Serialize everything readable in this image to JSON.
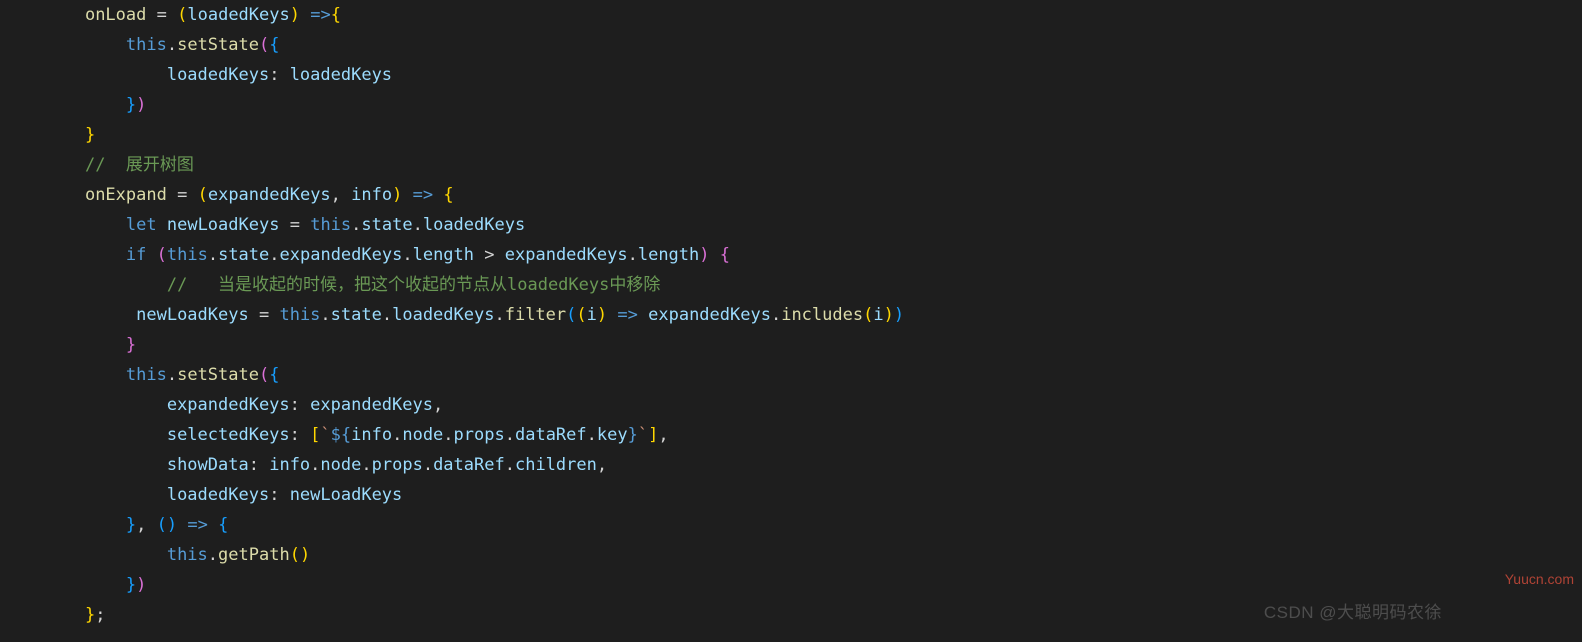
{
  "lines": [
    {
      "indent": "    ",
      "tokens": [
        {
          "t": "onLoad",
          "c": "tk-fn"
        },
        {
          "t": " "
        },
        {
          "t": "=",
          "c": "tk-op"
        },
        {
          "t": " "
        },
        {
          "t": "(",
          "c": "tk-brace-y"
        },
        {
          "t": "loadedKeys",
          "c": "tk-var"
        },
        {
          "t": ")",
          "c": "tk-brace-y"
        },
        {
          "t": " "
        },
        {
          "t": "=>",
          "c": "tk-kw"
        },
        {
          "t": "{",
          "c": "tk-brace-y"
        }
      ]
    },
    {
      "indent": "        ",
      "tokens": [
        {
          "t": "this",
          "c": "tk-this"
        },
        {
          "t": ".",
          "c": "tk-punc"
        },
        {
          "t": "setState",
          "c": "tk-fn"
        },
        {
          "t": "(",
          "c": "tk-brace-p"
        },
        {
          "t": "{",
          "c": "tk-brace-b"
        }
      ]
    },
    {
      "indent": "            ",
      "tokens": [
        {
          "t": "loadedKeys",
          "c": "tk-prop"
        },
        {
          "t": ":",
          "c": "tk-punc"
        },
        {
          "t": " "
        },
        {
          "t": "loadedKeys",
          "c": "tk-var"
        }
      ]
    },
    {
      "indent": "        ",
      "tokens": [
        {
          "t": "}",
          "c": "tk-brace-b"
        },
        {
          "t": ")",
          "c": "tk-brace-p"
        }
      ]
    },
    {
      "indent": "    ",
      "tokens": [
        {
          "t": "}",
          "c": "tk-brace-y"
        }
      ]
    },
    {
      "indent": "    ",
      "tokens": [
        {
          "t": "//  展开树图",
          "c": "tk-comment"
        }
      ]
    },
    {
      "indent": "    ",
      "tokens": [
        {
          "t": "onExpand",
          "c": "tk-fn"
        },
        {
          "t": " "
        },
        {
          "t": "=",
          "c": "tk-op"
        },
        {
          "t": " "
        },
        {
          "t": "(",
          "c": "tk-brace-y"
        },
        {
          "t": "expandedKeys",
          "c": "tk-var"
        },
        {
          "t": ", ",
          "c": "tk-punc"
        },
        {
          "t": "info",
          "c": "tk-var"
        },
        {
          "t": ")",
          "c": "tk-brace-y"
        },
        {
          "t": " "
        },
        {
          "t": "=>",
          "c": "tk-kw"
        },
        {
          "t": " "
        },
        {
          "t": "{",
          "c": "tk-brace-y"
        }
      ]
    },
    {
      "indent": "        ",
      "tokens": [
        {
          "t": "let",
          "c": "tk-kw"
        },
        {
          "t": " "
        },
        {
          "t": "newLoadKeys",
          "c": "tk-var"
        },
        {
          "t": " "
        },
        {
          "t": "=",
          "c": "tk-op"
        },
        {
          "t": " "
        },
        {
          "t": "this",
          "c": "tk-this"
        },
        {
          "t": ".",
          "c": "tk-punc"
        },
        {
          "t": "state",
          "c": "tk-prop"
        },
        {
          "t": ".",
          "c": "tk-punc"
        },
        {
          "t": "loadedKeys",
          "c": "tk-prop"
        }
      ]
    },
    {
      "indent": "        ",
      "tokens": [
        {
          "t": "if",
          "c": "tk-kw"
        },
        {
          "t": " "
        },
        {
          "t": "(",
          "c": "tk-brace-p"
        },
        {
          "t": "this",
          "c": "tk-this"
        },
        {
          "t": ".",
          "c": "tk-punc"
        },
        {
          "t": "state",
          "c": "tk-prop"
        },
        {
          "t": ".",
          "c": "tk-punc"
        },
        {
          "t": "expandedKeys",
          "c": "tk-prop"
        },
        {
          "t": ".",
          "c": "tk-punc"
        },
        {
          "t": "length",
          "c": "tk-prop"
        },
        {
          "t": " "
        },
        {
          "t": ">",
          "c": "tk-op"
        },
        {
          "t": " "
        },
        {
          "t": "expandedKeys",
          "c": "tk-var"
        },
        {
          "t": ".",
          "c": "tk-punc"
        },
        {
          "t": "length",
          "c": "tk-prop"
        },
        {
          "t": ")",
          "c": "tk-brace-p"
        },
        {
          "t": " "
        },
        {
          "t": "{",
          "c": "tk-brace-p"
        }
      ]
    },
    {
      "indent": "            ",
      "tokens": [
        {
          "t": "//   当是收起的时候，把这个收起的节点从loadedKeys中移除",
          "c": "tk-comment"
        }
      ]
    },
    {
      "indent": "         ",
      "tokens": [
        {
          "t": "newLoadKeys",
          "c": "tk-var"
        },
        {
          "t": " "
        },
        {
          "t": "=",
          "c": "tk-op"
        },
        {
          "t": " "
        },
        {
          "t": "this",
          "c": "tk-this"
        },
        {
          "t": ".",
          "c": "tk-punc"
        },
        {
          "t": "state",
          "c": "tk-prop"
        },
        {
          "t": ".",
          "c": "tk-punc"
        },
        {
          "t": "loadedKeys",
          "c": "tk-prop"
        },
        {
          "t": ".",
          "c": "tk-punc"
        },
        {
          "t": "filter",
          "c": "tk-fn"
        },
        {
          "t": "(",
          "c": "tk-brace-b"
        },
        {
          "t": "(",
          "c": "tk-brace-y"
        },
        {
          "t": "i",
          "c": "tk-var"
        },
        {
          "t": ")",
          "c": "tk-brace-y"
        },
        {
          "t": " "
        },
        {
          "t": "=>",
          "c": "tk-kw"
        },
        {
          "t": " "
        },
        {
          "t": "expandedKeys",
          "c": "tk-var"
        },
        {
          "t": ".",
          "c": "tk-punc"
        },
        {
          "t": "includes",
          "c": "tk-fn"
        },
        {
          "t": "(",
          "c": "tk-brace-y"
        },
        {
          "t": "i",
          "c": "tk-var"
        },
        {
          "t": ")",
          "c": "tk-brace-y"
        },
        {
          "t": ")",
          "c": "tk-brace-b"
        }
      ]
    },
    {
      "indent": "        ",
      "tokens": [
        {
          "t": "}",
          "c": "tk-brace-p"
        }
      ]
    },
    {
      "indent": "        ",
      "tokens": [
        {
          "t": "this",
          "c": "tk-this"
        },
        {
          "t": ".",
          "c": "tk-punc"
        },
        {
          "t": "setState",
          "c": "tk-fn"
        },
        {
          "t": "(",
          "c": "tk-brace-p"
        },
        {
          "t": "{",
          "c": "tk-brace-b"
        }
      ]
    },
    {
      "indent": "            ",
      "tokens": [
        {
          "t": "expandedKeys",
          "c": "tk-prop"
        },
        {
          "t": ":",
          "c": "tk-punc"
        },
        {
          "t": " "
        },
        {
          "t": "expandedKeys",
          "c": "tk-var"
        },
        {
          "t": ",",
          "c": "tk-punc"
        }
      ]
    },
    {
      "indent": "            ",
      "tokens": [
        {
          "t": "selectedKeys",
          "c": "tk-prop"
        },
        {
          "t": ":",
          "c": "tk-punc"
        },
        {
          "t": " "
        },
        {
          "t": "[",
          "c": "tk-brace-y"
        },
        {
          "t": "`",
          "c": "tk-str"
        },
        {
          "t": "${",
          "c": "tk-kw"
        },
        {
          "t": "info",
          "c": "tk-var"
        },
        {
          "t": ".",
          "c": "tk-punc"
        },
        {
          "t": "node",
          "c": "tk-prop"
        },
        {
          "t": ".",
          "c": "tk-punc"
        },
        {
          "t": "props",
          "c": "tk-prop"
        },
        {
          "t": ".",
          "c": "tk-punc"
        },
        {
          "t": "dataRef",
          "c": "tk-prop"
        },
        {
          "t": ".",
          "c": "tk-punc"
        },
        {
          "t": "key",
          "c": "tk-prop"
        },
        {
          "t": "}",
          "c": "tk-kw"
        },
        {
          "t": "`",
          "c": "tk-str"
        },
        {
          "t": "]",
          "c": "tk-brace-y"
        },
        {
          "t": ",",
          "c": "tk-punc"
        }
      ]
    },
    {
      "indent": "            ",
      "tokens": [
        {
          "t": "showData",
          "c": "tk-prop"
        },
        {
          "t": ":",
          "c": "tk-punc"
        },
        {
          "t": " "
        },
        {
          "t": "info",
          "c": "tk-var"
        },
        {
          "t": ".",
          "c": "tk-punc"
        },
        {
          "t": "node",
          "c": "tk-prop"
        },
        {
          "t": ".",
          "c": "tk-punc"
        },
        {
          "t": "props",
          "c": "tk-prop"
        },
        {
          "t": ".",
          "c": "tk-punc"
        },
        {
          "t": "dataRef",
          "c": "tk-prop"
        },
        {
          "t": ".",
          "c": "tk-punc"
        },
        {
          "t": "children",
          "c": "tk-prop"
        },
        {
          "t": ",",
          "c": "tk-punc"
        }
      ]
    },
    {
      "indent": "            ",
      "tokens": [
        {
          "t": "loadedKeys",
          "c": "tk-prop"
        },
        {
          "t": ":",
          "c": "tk-punc"
        },
        {
          "t": " "
        },
        {
          "t": "newLoadKeys",
          "c": "tk-var"
        }
      ]
    },
    {
      "indent": "        ",
      "tokens": [
        {
          "t": "}",
          "c": "tk-brace-b"
        },
        {
          "t": ", ",
          "c": "tk-punc"
        },
        {
          "t": "(",
          "c": "tk-brace-b"
        },
        {
          "t": ")",
          "c": "tk-brace-b"
        },
        {
          "t": " "
        },
        {
          "t": "=>",
          "c": "tk-kw"
        },
        {
          "t": " "
        },
        {
          "t": "{",
          "c": "tk-brace-b"
        }
      ]
    },
    {
      "indent": "            ",
      "tokens": [
        {
          "t": "this",
          "c": "tk-this"
        },
        {
          "t": ".",
          "c": "tk-punc"
        },
        {
          "t": "getPath",
          "c": "tk-fn"
        },
        {
          "t": "(",
          "c": "tk-brace-y"
        },
        {
          "t": ")",
          "c": "tk-brace-y"
        }
      ]
    },
    {
      "indent": "        ",
      "tokens": [
        {
          "t": "}",
          "c": "tk-brace-b"
        },
        {
          "t": ")",
          "c": "tk-brace-p"
        }
      ]
    },
    {
      "indent": "    ",
      "tokens": [
        {
          "t": "}",
          "c": "tk-brace-y"
        },
        {
          "t": ";",
          "c": "tk-punc"
        }
      ]
    }
  ],
  "watermark_bottom": "CSDN @大聪明码农徐",
  "watermark_right": "Yuucn.com"
}
